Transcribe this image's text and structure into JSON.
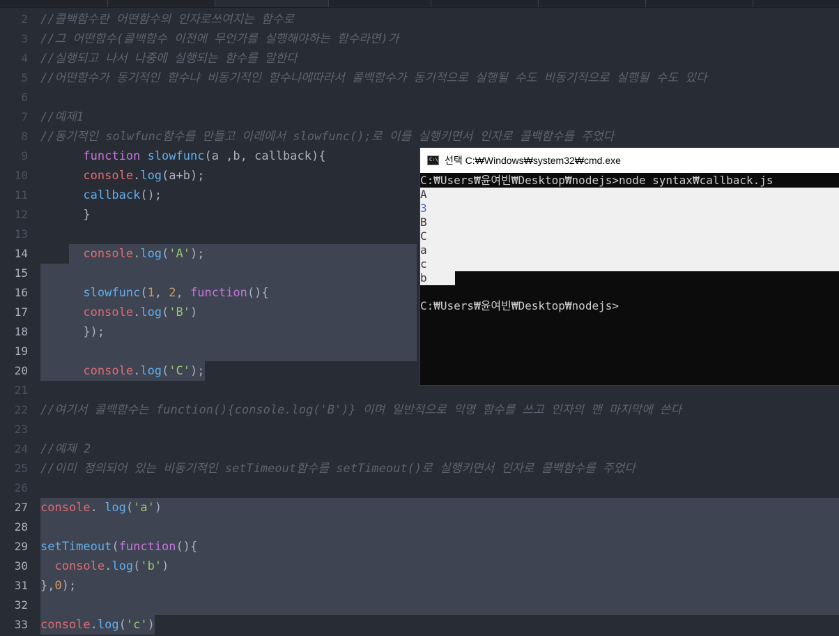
{
  "editor": {
    "lines": [
      {
        "n": "2",
        "segs": [
          {
            "t": "//콜백함수란 어떤함수의 인자로쓰여지는 함수로",
            "c": "cm"
          }
        ]
      },
      {
        "n": "3",
        "segs": [
          {
            "t": "//그 어떤함수(콜백함수 이전에 무언가를 실행해야하는 함수라면)가",
            "c": "cm"
          }
        ]
      },
      {
        "n": "4",
        "segs": [
          {
            "t": "//실행되고 나서 나중에 실행되는 함수를 말한다",
            "c": "cm"
          }
        ]
      },
      {
        "n": "5",
        "segs": [
          {
            "t": "//어떤함수가 동기적인 함수냐 비동기적인 함수냐에따라서 콜백함수가 동기적으로 실행될 수도 비동기적으로 실행될 수도 있다",
            "c": "cm"
          }
        ]
      },
      {
        "n": "6",
        "segs": []
      },
      {
        "n": "7",
        "segs": [
          {
            "t": "//예제1",
            "c": "cm"
          }
        ]
      },
      {
        "n": "8",
        "segs": [
          {
            "t": "//동기적인 solwfunc함수를 만들고 아래에서 slowfunc();로 이를 실행키면서 인자로 콜백함수를 주었다",
            "c": "cm"
          }
        ]
      },
      {
        "n": "9",
        "segs": [
          {
            "t": "      "
          },
          {
            "t": "function",
            "c": "kw"
          },
          {
            "t": " "
          },
          {
            "t": "slowfunc",
            "c": "fn"
          },
          {
            "t": "(a ,b, callback){",
            "c": "pl"
          }
        ]
      },
      {
        "n": "10",
        "segs": [
          {
            "t": "      "
          },
          {
            "t": "console",
            "c": "vr"
          },
          {
            "t": ".",
            "c": "pl"
          },
          {
            "t": "log",
            "c": "fn"
          },
          {
            "t": "(a+b);",
            "c": "pl"
          }
        ]
      },
      {
        "n": "11",
        "segs": [
          {
            "t": "      "
          },
          {
            "t": "callback",
            "c": "fn"
          },
          {
            "t": "();",
            "c": "pl"
          }
        ]
      },
      {
        "n": "12",
        "segs": [
          {
            "t": "      "
          },
          {
            "t": "}",
            "c": "pl"
          }
        ]
      },
      {
        "n": "13",
        "segs": []
      },
      {
        "n": "14",
        "segs": [
          {
            "t": "      "
          },
          {
            "t": "console",
            "c": "vr"
          },
          {
            "t": ".",
            "c": "pl"
          },
          {
            "t": "log",
            "c": "fn"
          },
          {
            "t": "(",
            "c": "pl"
          },
          {
            "t": "'A'",
            "c": "st"
          },
          {
            "t": ");",
            "c": "pl"
          }
        ]
      },
      {
        "n": "15",
        "segs": []
      },
      {
        "n": "16",
        "segs": [
          {
            "t": "      "
          },
          {
            "t": "slowfunc",
            "c": "fn"
          },
          {
            "t": "(",
            "c": "pl"
          },
          {
            "t": "1",
            "c": "nm"
          },
          {
            "t": ", ",
            "c": "pl"
          },
          {
            "t": "2",
            "c": "nm"
          },
          {
            "t": ", ",
            "c": "pl"
          },
          {
            "t": "function",
            "c": "kw"
          },
          {
            "t": "(){",
            "c": "pl"
          }
        ]
      },
      {
        "n": "17",
        "segs": [
          {
            "t": "      "
          },
          {
            "t": "console",
            "c": "vr"
          },
          {
            "t": ".",
            "c": "pl"
          },
          {
            "t": "log",
            "c": "fn"
          },
          {
            "t": "(",
            "c": "pl"
          },
          {
            "t": "'B'",
            "c": "st"
          },
          {
            "t": ")",
            "c": "pl"
          }
        ]
      },
      {
        "n": "18",
        "segs": [
          {
            "t": "      "
          },
          {
            "t": "});",
            "c": "pl"
          }
        ]
      },
      {
        "n": "19",
        "segs": []
      },
      {
        "n": "20",
        "segs": [
          {
            "t": "      "
          },
          {
            "t": "console",
            "c": "vr"
          },
          {
            "t": ".",
            "c": "pl"
          },
          {
            "t": "log",
            "c": "fn"
          },
          {
            "t": "(",
            "c": "pl"
          },
          {
            "t": "'C'",
            "c": "st"
          },
          {
            "t": ");",
            "c": "pl"
          }
        ]
      },
      {
        "n": "21",
        "segs": []
      },
      {
        "n": "22",
        "segs": [
          {
            "t": "//여기서 콜백함수는 function(){console.log('B')} 이며 일반적으로 익명 함수를 쓰고 인자의 맨 마지막에 쓴다",
            "c": "cm"
          }
        ]
      },
      {
        "n": "23",
        "segs": []
      },
      {
        "n": "24",
        "segs": [
          {
            "t": "//예제 2",
            "c": "cm"
          }
        ]
      },
      {
        "n": "25",
        "segs": [
          {
            "t": "//이미 정의되어 있는 비동기적인 setTimeout함수를 setTimeout()로 실행키면서 인자로 콜백함수를 주었다",
            "c": "cm"
          }
        ]
      },
      {
        "n": "26",
        "segs": []
      },
      {
        "n": "27",
        "segs": [
          {
            "t": "console",
            "c": "vr"
          },
          {
            "t": ". ",
            "c": "pl"
          },
          {
            "t": "log",
            "c": "fn"
          },
          {
            "t": "(",
            "c": "pl"
          },
          {
            "t": "'a'",
            "c": "st"
          },
          {
            "t": ")",
            "c": "pl"
          }
        ]
      },
      {
        "n": "28",
        "segs": []
      },
      {
        "n": "29",
        "segs": [
          {
            "t": "setTimeout",
            "c": "fn"
          },
          {
            "t": "(",
            "c": "pl"
          },
          {
            "t": "function",
            "c": "kw"
          },
          {
            "t": "(){",
            "c": "pl"
          }
        ]
      },
      {
        "n": "30",
        "segs": [
          {
            "t": "  "
          },
          {
            "t": "console",
            "c": "vr"
          },
          {
            "t": ".",
            "c": "pl"
          },
          {
            "t": "log",
            "c": "fn"
          },
          {
            "t": "(",
            "c": "pl"
          },
          {
            "t": "'b'",
            "c": "st"
          },
          {
            "t": ")",
            "c": "pl"
          }
        ]
      },
      {
        "n": "31",
        "segs": [
          {
            "t": "},",
            "c": "pl"
          },
          {
            "t": "0",
            "c": "nm"
          },
          {
            "t": ");",
            "c": "pl"
          }
        ]
      },
      {
        "n": "32",
        "segs": []
      },
      {
        "n": "33",
        "segs": [
          {
            "t": "console",
            "c": "vr"
          },
          {
            "t": ".",
            "c": "pl"
          },
          {
            "t": "log",
            "c": "fn"
          },
          {
            "t": "(",
            "c": "pl"
          },
          {
            "t": "'c'",
            "c": "st"
          },
          {
            "t": ")",
            "c": "pl"
          }
        ]
      }
    ]
  },
  "cmd": {
    "title": "선택 C:₩Windows₩system32₩cmd.exe",
    "icon_label": "C:\\",
    "lines": [
      "C:₩Users₩윤여빈₩Desktop₩nodejs>node syntax₩callback.js",
      "A",
      "3",
      "B",
      "C",
      "a",
      "c",
      "b",
      "",
      "C:₩Users₩윤여빈₩Desktop₩nodejs>"
    ]
  },
  "colors": {
    "editor_bg": "#282c34",
    "selection": "#3e4451",
    "comment": "#5c6370",
    "keyword": "#c678dd",
    "function": "#61afef",
    "variable": "#e06c75",
    "string": "#98c379",
    "number": "#d19a66",
    "console_bg": "#0c0c0c",
    "console_selection": "#f0f0f0"
  }
}
